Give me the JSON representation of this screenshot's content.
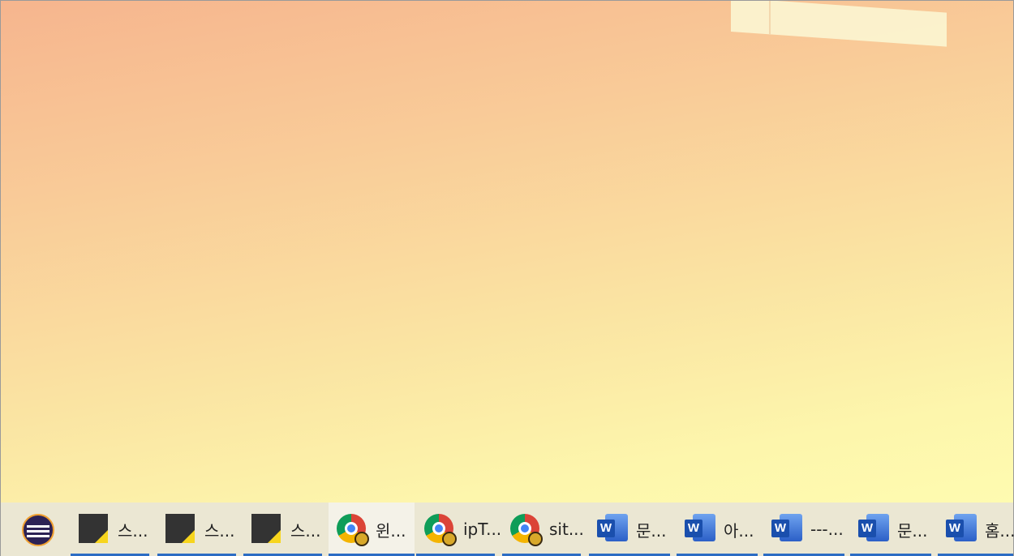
{
  "taskbar": {
    "items": [
      {
        "app": "eclipse",
        "icon": "eclipse-icon",
        "label": ""
      },
      {
        "app": "sticky-notes",
        "icon": "sticky-notes-icon",
        "label": "스..."
      },
      {
        "app": "sticky-notes",
        "icon": "sticky-notes-icon",
        "label": "스..."
      },
      {
        "app": "sticky-notes",
        "icon": "sticky-notes-icon",
        "label": "스..."
      },
      {
        "app": "chrome",
        "icon": "chrome-icon",
        "label": "윈..."
      },
      {
        "app": "chrome",
        "icon": "chrome-icon",
        "label": "ipT..."
      },
      {
        "app": "chrome",
        "icon": "chrome-icon",
        "label": "sit..."
      },
      {
        "app": "word",
        "icon": "word-icon",
        "label": "문..."
      },
      {
        "app": "word",
        "icon": "word-icon",
        "label": "아..."
      },
      {
        "app": "word",
        "icon": "word-icon",
        "label": "---..."
      },
      {
        "app": "word",
        "icon": "word-icon",
        "label": "문..."
      },
      {
        "app": "word",
        "icon": "word-icon",
        "label": "홈..."
      }
    ]
  },
  "colors": {
    "accent": "#2b6cc4",
    "taskbar_bg": "#ebe7d3"
  }
}
